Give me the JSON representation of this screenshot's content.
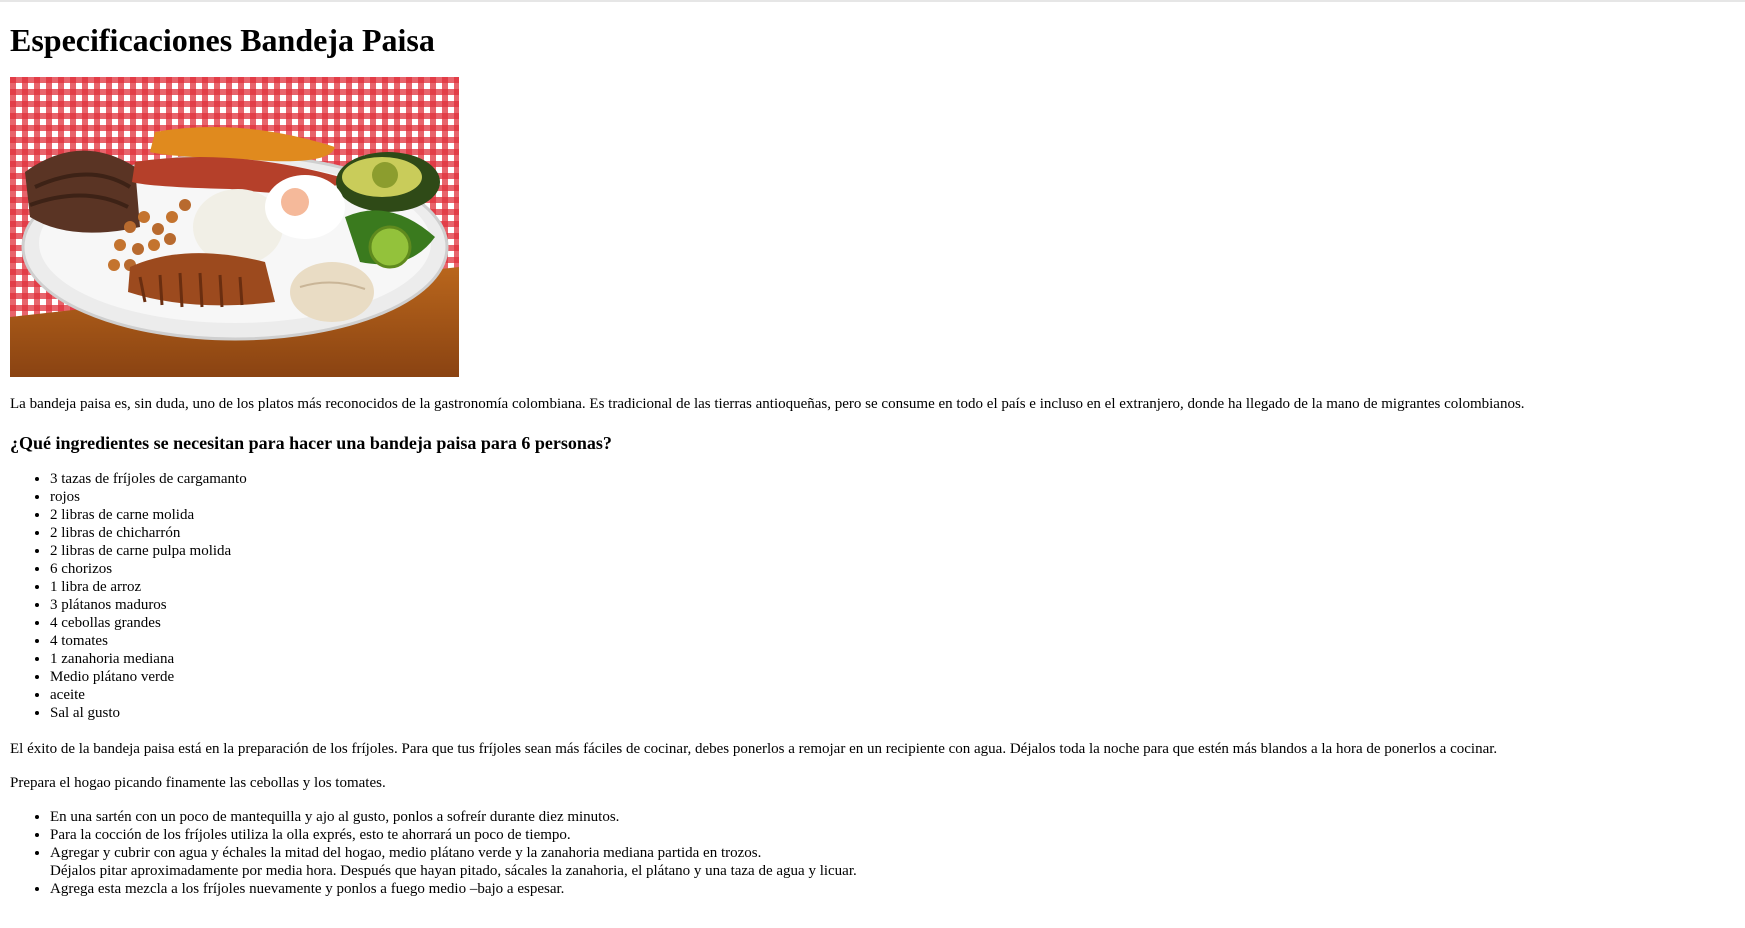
{
  "title": "Especificaciones Bandeja Paisa",
  "image": {
    "alt": "Bandeja paisa"
  },
  "intro": "La bandeja paisa es, sin duda, uno de los platos más reconocidos de la gastronomía colombiana. Es tradicional de las tierras antioqueñas, pero se consume en todo el país e incluso en el extranjero, donde ha llegado de la mano de migrantes colombianos.",
  "ingredients_heading": "¿Qué ingredientes se necesitan para hacer una bandeja paisa para 6 personas?",
  "ingredients": [
    "3 tazas de fríjoles de cargamanto",
    "rojos",
    "2 libras de carne molida",
    "2 libras de chicharrón",
    "2 libras de carne pulpa molida",
    "6 chorizos",
    "1 libra de arroz",
    "3 plátanos maduros",
    "4 cebollas grandes",
    "4 tomates",
    "1 zanahoria mediana",
    "Medio plátano verde",
    "aceite",
    "Sal al gusto"
  ],
  "success_paragraph": "El éxito de la bandeja paisa está en la preparación de los fríjoles. Para que tus fríjoles sean más fáciles de cocinar, debes ponerlos a remojar en un recipiente con agua. Déjalos toda la noche para que estén más blandos a la hora de ponerlos a cocinar.",
  "hogao_paragraph": "Prepara el hogao picando finamente las cebollas y los tomates.",
  "steps": [
    "En una sartén con un poco de mantequilla y ajo al gusto, ponlos a sofreír durante diez minutos.",
    "Para la cocción de los fríjoles utiliza la olla exprés, esto te ahorrará un poco de tiempo.",
    "Agregar y cubrir con agua y échales la mitad del hogao, medio plátano verde y la zanahoria mediana partida en trozos.",
    "Déjalos pitar aproximadamente por media hora. Después que hayan pitado, sácales la zanahoria, el plátano y una taza de agua y licuar.",
    "Agrega esta mezcla a los fríjoles nuevamente y ponlos a fuego medio –bajo a espesar."
  ]
}
